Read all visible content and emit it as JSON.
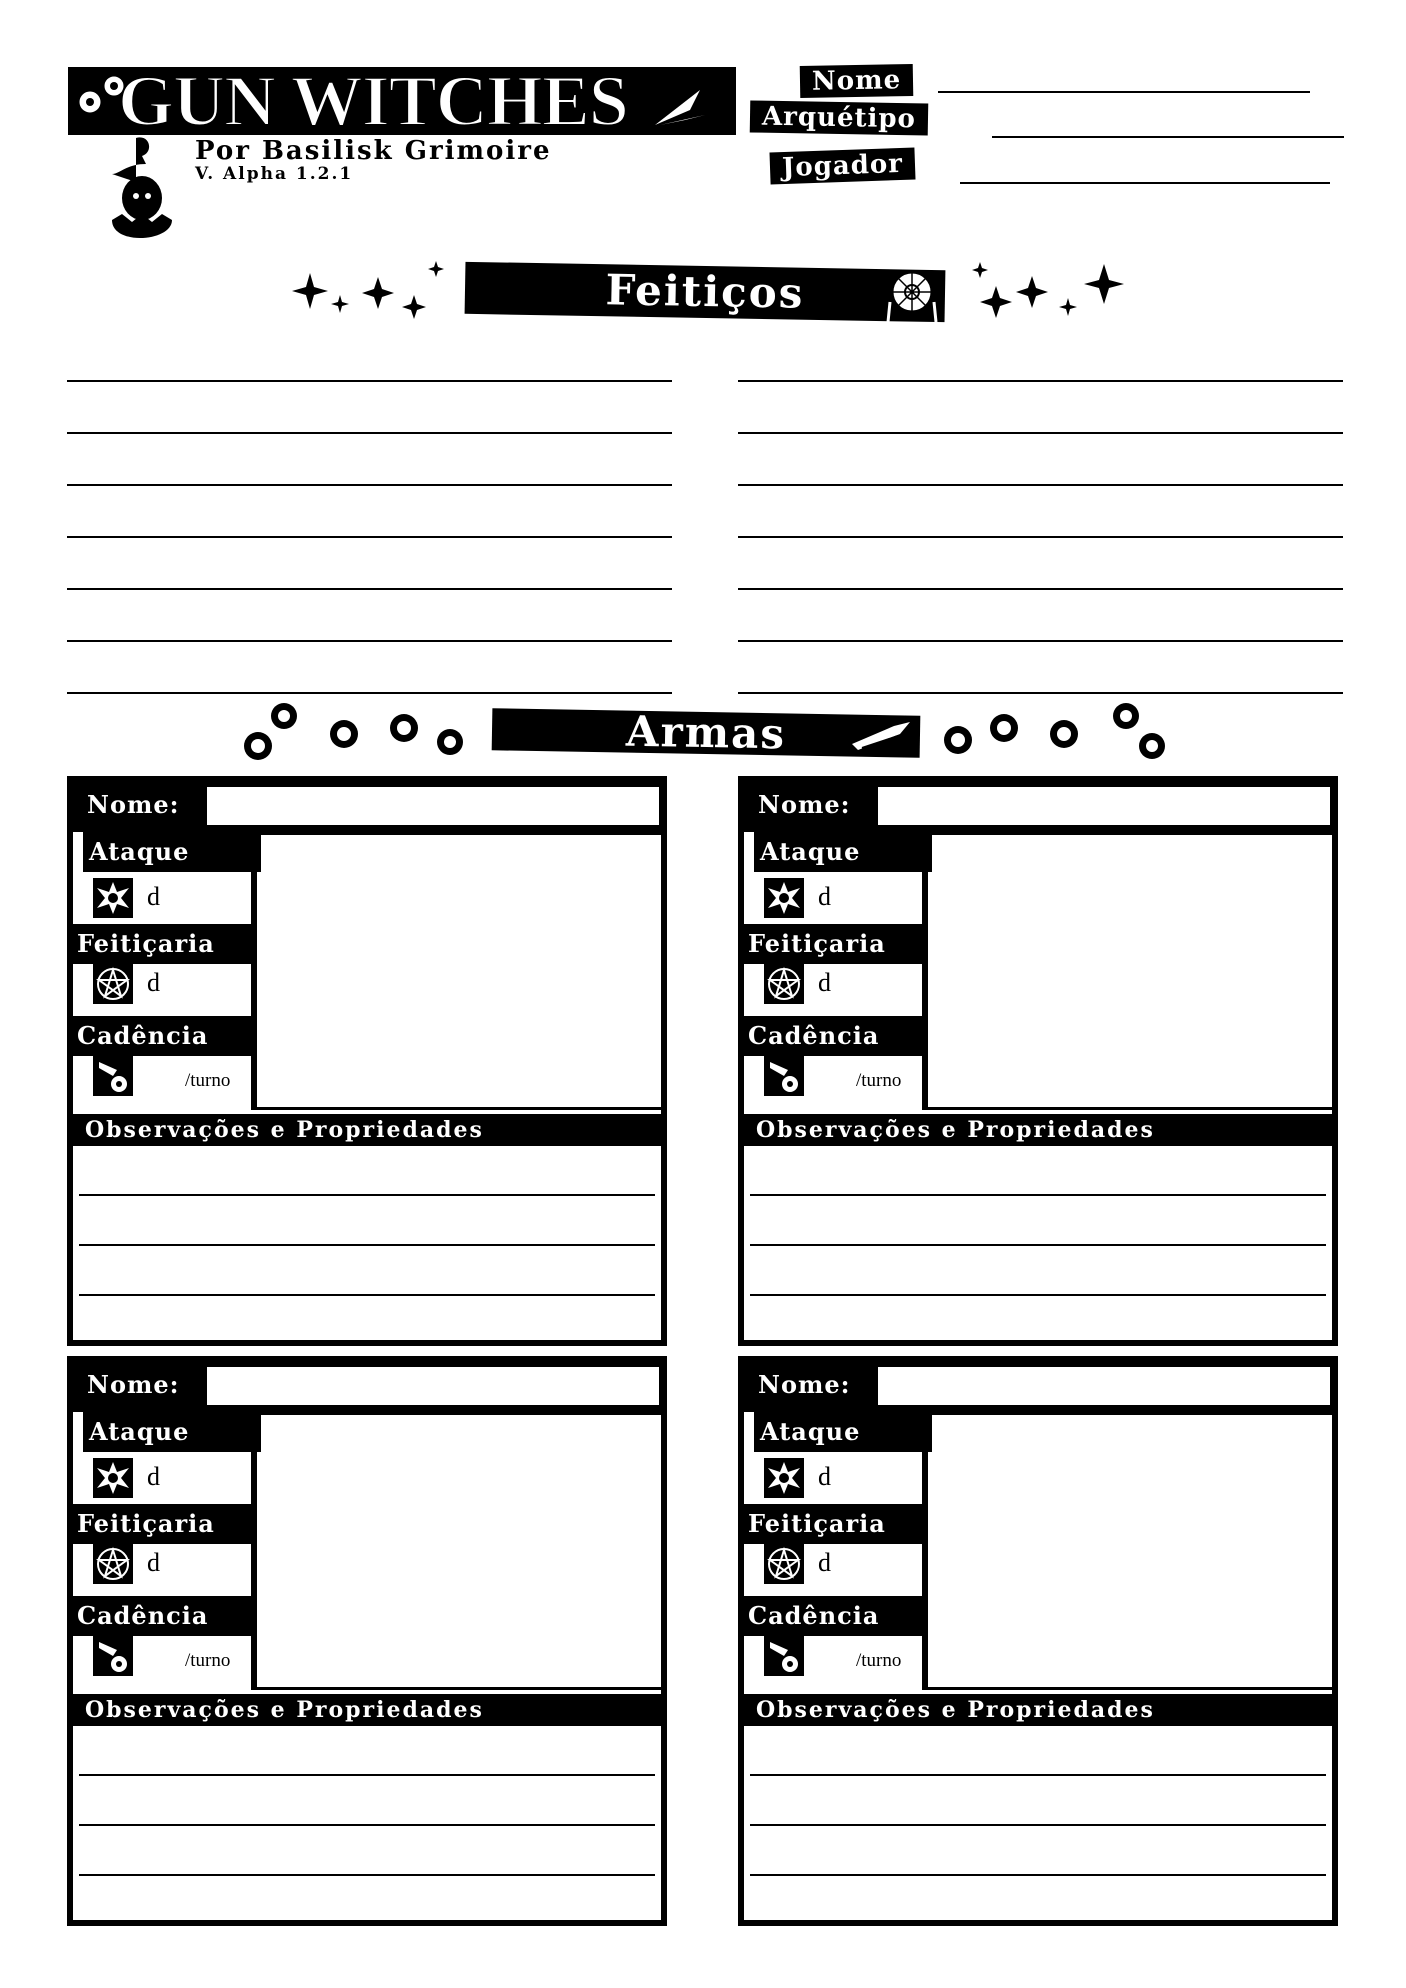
{
  "header": {
    "logo": "GUN WITCHES",
    "byline": "Por Basilisk Grimoire",
    "version": "V. Alpha 1.2.1",
    "fields": {
      "nome": "Nome",
      "arquetipo": "Arquétipo",
      "jogador": "Jogador"
    }
  },
  "sections": {
    "spells": "Feitiços",
    "weapons": "Armas"
  },
  "weapon_card": {
    "nome_label": "Nome:",
    "ataque_label": "Ataque",
    "feiticaria_label": "Feitiçaria",
    "cadencia_label": "Cadência",
    "die_unit": "d",
    "rate_unit": "/turno",
    "obs_label": "Observações e Propriedades"
  },
  "icons": [
    "bullet-hole-icon",
    "pentagram-icon",
    "gun-chamber-icon",
    "sparkle-icon",
    "dreamcatcher-icon",
    "bullet-icon",
    "witch-hat-egg-icon"
  ],
  "colors": {
    "ink": "#000000",
    "paper": "#ffffff"
  }
}
